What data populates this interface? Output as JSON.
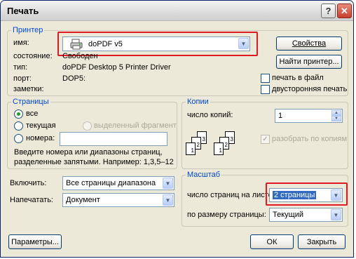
{
  "window": {
    "title": "Печать"
  },
  "titlebar": {
    "help_glyph": "?",
    "close_glyph": "✕"
  },
  "printer": {
    "legend": "Принтер",
    "name_label": "имя:",
    "name_value": "doPDF v5",
    "status_label": "состояние:",
    "status_value": "Свободен",
    "type_label": "тип:",
    "type_value": "doPDF Desktop 5 Printer Driver",
    "port_label": "порт:",
    "port_value": "DOP5:",
    "notes_label": "заметки:",
    "properties_button": "Свойства",
    "find_printer_button": "Найти принтер...",
    "print_to_file_label": "печать в файл",
    "duplex_label": "двусторонняя печать"
  },
  "pages": {
    "legend": "Страницы",
    "all_label": "все",
    "current_label": "текущая",
    "selection_label": "выделенный фрагмент",
    "numbers_label": "номера:",
    "numbers_value": "",
    "hint_line1": "Введите номера или диапазоны страниц,",
    "hint_line2": "разделенные запятыми. Например: 1,3,5–12"
  },
  "copies": {
    "legend": "Копии",
    "count_label": "число копий:",
    "count_value": "1",
    "collate_label": "разобрать по копиям",
    "collate_icon_pages": [
      "1",
      "2",
      "3"
    ]
  },
  "include": {
    "label": "Включить:",
    "value": "Все страницы диапазона"
  },
  "print_what": {
    "label": "Напечатать:",
    "value": "Документ"
  },
  "scale": {
    "legend": "Масштаб",
    "pages_per_sheet_label": "число страниц на листе:",
    "pages_per_sheet_value": "2 страницы",
    "fit_label": "по размеру страницы:",
    "fit_value": "Текущий"
  },
  "footer": {
    "options_button": "Параметры...",
    "ok_button": "ОК",
    "close_button": "Закрыть"
  },
  "colors": {
    "accent": "#0046d5",
    "highlight": "#e01b24"
  }
}
